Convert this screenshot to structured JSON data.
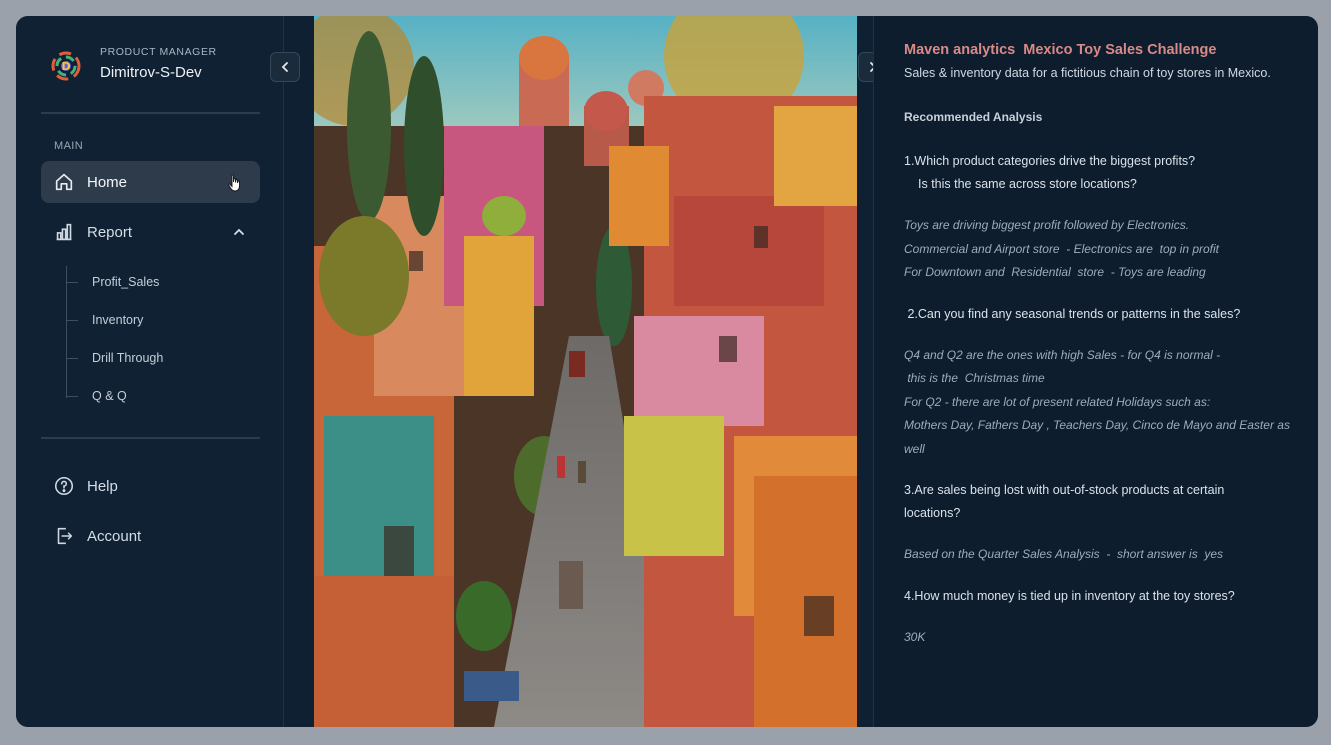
{
  "sidebar": {
    "role": "PRODUCT MANAGER",
    "user": "Dimitrov-S-Dev",
    "section_label": "MAIN",
    "home_label": "Home",
    "report_label": "Report",
    "sub_items": [
      "Profit_Sales",
      "Inventory",
      "Drill Through",
      "Q & Q"
    ],
    "help_label": "Help",
    "account_label": "Account"
  },
  "info": {
    "title": "Maven analytics  Mexico Toy Sales Challenge",
    "subtitle": "Sales & inventory data for a fictitious chain of toy stores in Mexico.",
    "heading": "Recommended Analysis",
    "q1_line1": "1.Which product categories drive the biggest profits?",
    "q1_line2": "Is this the same across store locations?",
    "a1_line1": "Toys are driving biggest profit followed by Electronics.",
    "a1_line2": "Commercial and Airport store  - Electronics are  top in profit",
    "a1_line3": "For Downtown and  Residential  store  - Toys are leading",
    "q2": " 2.Can you find any seasonal trends or patterns in the sales?",
    "a2_line1": "Q4 and Q2 are the ones with high Sales - for Q4 is normal -",
    "a2_line2": " this is the  Christmas time",
    "a2_line3": "For Q2 - there are lot of present related Holidays such as:",
    "a2_line4": "Mothers Day, Fathers Day , Teachers Day, Cinco de Mayo and Easter as well",
    "q3": "3.Are sales being lost with out-of-stock products at certain locations?",
    "a3": "Based on the Quarter Sales Analysis  -  short answer is  yes",
    "q4": "4.How much money is tied up in inventory at the toy stores?",
    "a4": "30K"
  },
  "colors": {
    "accent_title": "#d98a86",
    "sidebar_bg": "#0f2133",
    "active_bg": "#2d3b4b"
  },
  "icons": [
    "app-logo-icon",
    "home-icon",
    "report-bar-icon",
    "chevron-up-icon",
    "help-icon",
    "account-exit-icon",
    "chevron-left-icon",
    "chevron-right-icon",
    "hand-cursor-icon"
  ]
}
